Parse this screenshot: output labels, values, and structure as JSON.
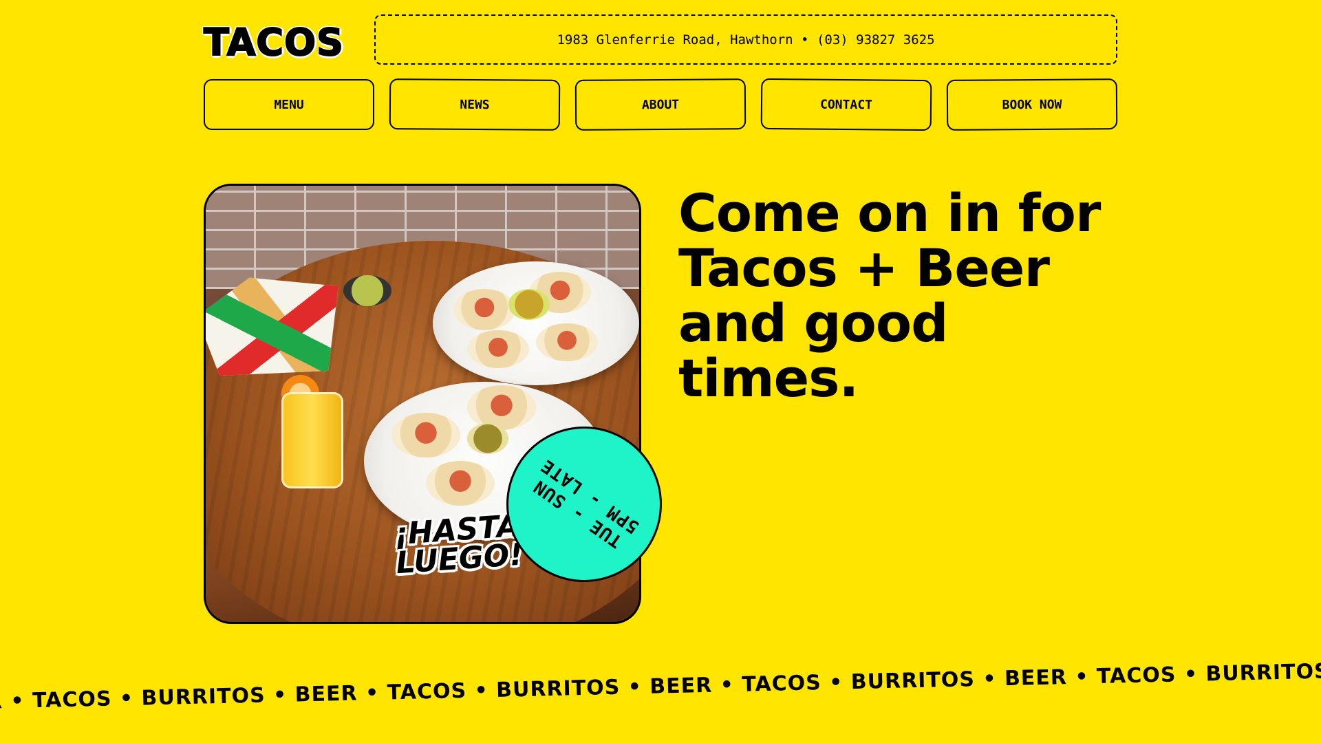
{
  "header": {
    "logo": "TACOS",
    "address": "1983 Glenferrie Road, Hawthorn • (03) 93827 3625"
  },
  "nav": {
    "items": [
      {
        "label": "MENU"
      },
      {
        "label": "NEWS"
      },
      {
        "label": "ABOUT"
      },
      {
        "label": "CONTACT"
      },
      {
        "label": "BOOK NOW"
      }
    ]
  },
  "hero": {
    "headline": "Come on in for Tacos + Beer and good times.",
    "sticker_text": "¡HASTA\nLUEGO!",
    "hours_line1": "TUE - SUN",
    "hours_line2": "5PM - LATE"
  },
  "marquee": {
    "text": "R • TACOS • BURRITOS • BEER • TACOS • BURRITOS • BEER • TACOS • BURRITOS • BEER • TACOS • BURRITOS • BE"
  },
  "colors": {
    "background": "#ffe500",
    "badge": "#1ff3c8",
    "text": "#000000"
  }
}
